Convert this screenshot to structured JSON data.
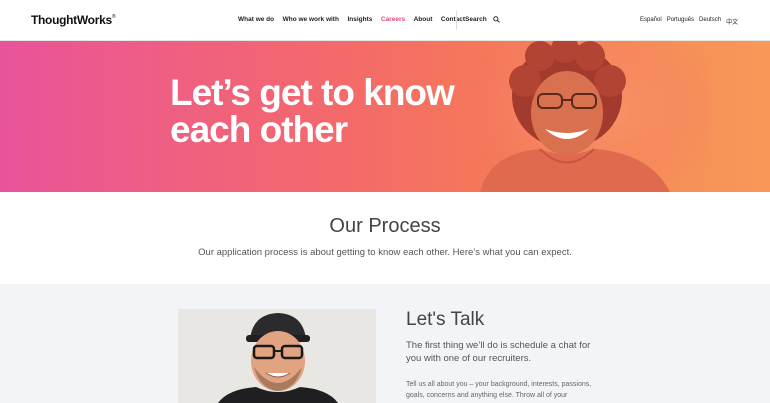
{
  "header": {
    "logo": "ThoughtWorks",
    "logo_mark": "®",
    "nav": [
      {
        "label": "What we do"
      },
      {
        "label": "Who we work with"
      },
      {
        "label": "Insights"
      },
      {
        "label": "Careers"
      },
      {
        "label": "About"
      },
      {
        "label": "Contact"
      }
    ],
    "search_label": "Search",
    "languages": [
      "Español",
      "Português",
      "Deutsch",
      "中文"
    ]
  },
  "hero": {
    "line1": "Let’s get to know",
    "line2": "each other"
  },
  "process": {
    "title": "Our Process",
    "subtitle": "Our application process is about getting to know each other. Here’s what you can expect."
  },
  "talk": {
    "title": "Let's Talk",
    "lead": "The first thing we’ll do is schedule a chat for you with one of our recruiters.",
    "body": "Tell us all about you – your background, interests, passions, goals, concerns and anything else. Throw all of your"
  },
  "colors": {
    "accent": "#e5487a"
  }
}
